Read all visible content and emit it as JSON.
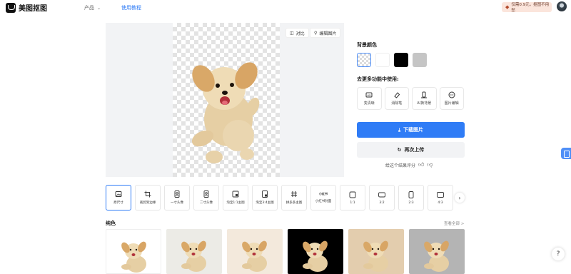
{
  "header": {
    "logo_text": "美图抠图",
    "nav_product": "产品",
    "nav_tutorial": "使用教程",
    "vip_text": "仅需0.9元，抠图不用愁"
  },
  "preview": {
    "compare_label": "对比",
    "edit_label": "编辑图片"
  },
  "panel": {
    "bg_color_label": "背景颜色",
    "swatches": [
      "transparent",
      "#ffffff",
      "#000000",
      "#c5c5c5"
    ],
    "more_tools_label": "去更多功能中使用:",
    "tools": [
      {
        "label": "变清晰",
        "icon": "hd-icon"
      },
      {
        "label": "消除笔",
        "icon": "eraser-icon"
      },
      {
        "label": "AI换背景",
        "icon": "ai-background-icon"
      },
      {
        "label": "图片编辑",
        "icon": "more-icon"
      }
    ],
    "download_label": "下载图片",
    "reupload_label": "再次上传",
    "rate_label": "给这个结果评分"
  },
  "sizes": [
    {
      "label": "原尺寸",
      "icon": "image-icon"
    },
    {
      "label": "裁剪到边缘",
      "icon": "crop-icon"
    },
    {
      "label": "一寸头像",
      "icon": "portrait-icon"
    },
    {
      "label": "二寸头像",
      "icon": "portrait-icon"
    },
    {
      "label": "淘宝1:1主图",
      "icon": "product-icon"
    },
    {
      "label": "淘宝3:4主图",
      "icon": "product-icon"
    },
    {
      "label": "拼多多主图",
      "icon": "pdd-icon"
    },
    {
      "label": "小红书封面",
      "icon": "xiaohongshu-icon",
      "icon_text": "小红书"
    },
    {
      "label": "1:1",
      "icon": "ratio-1-1-icon"
    },
    {
      "label": "3:2",
      "icon": "ratio-3-2-icon"
    },
    {
      "label": "2:3",
      "icon": "ratio-2-3-icon"
    },
    {
      "label": "4:3",
      "icon": "ratio-4-3-icon"
    }
  ],
  "backgrounds": {
    "title": "纯色",
    "view_all": "查看全部 >",
    "colors": [
      "#ffffff",
      "#ecebe6",
      "#f3e9dc",
      "#000000",
      "#e3cdae",
      "#b4b4b4"
    ]
  }
}
